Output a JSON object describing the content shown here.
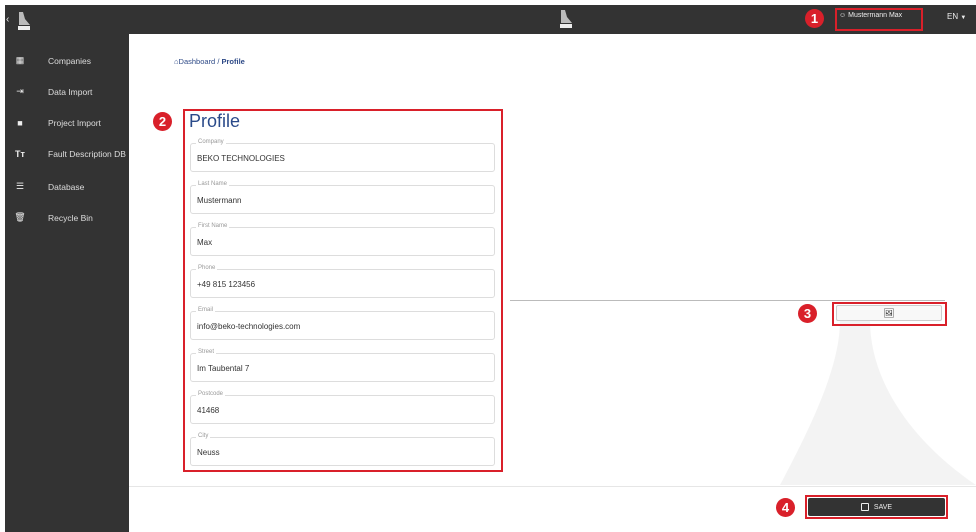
{
  "header": {
    "user_name": "Mustermann Max",
    "language": "EN",
    "collapse": "‹"
  },
  "sidebar": {
    "items": [
      {
        "label": "Companies",
        "icon": "building-icon"
      },
      {
        "label": "Data Import",
        "icon": "import-icon"
      },
      {
        "label": "Project Import",
        "icon": "briefcase-icon"
      },
      {
        "label": "Fault Description DB",
        "icon": "text-size-icon"
      },
      {
        "label": "Database",
        "icon": "list-icon"
      },
      {
        "label": "Recycle Bin",
        "icon": "trash-icon"
      }
    ]
  },
  "breadcrumb": {
    "home": "Dashboard",
    "sep": "/",
    "current": "Profile"
  },
  "profile": {
    "title": "Profile",
    "fields": [
      {
        "label": "Company",
        "value": "BEKO TECHNOLOGIES"
      },
      {
        "label": "Last Name",
        "value": "Mustermann"
      },
      {
        "label": "First Name",
        "value": "Max"
      },
      {
        "label": "Phone",
        "value": "+49 815 123456"
      },
      {
        "label": "Email",
        "value": "info@beko-technologies.com"
      },
      {
        "label": "Street",
        "value": "Im Taubental 7"
      },
      {
        "label": "Postcode",
        "value": "41468"
      },
      {
        "label": "City",
        "value": "Neuss"
      }
    ]
  },
  "actions": {
    "save": "SAVE"
  },
  "badges": [
    "1",
    "2",
    "3",
    "4"
  ],
  "colors": {
    "dark": "#333333",
    "accent": "#2a4a8a",
    "highlight": "#d9202a"
  }
}
